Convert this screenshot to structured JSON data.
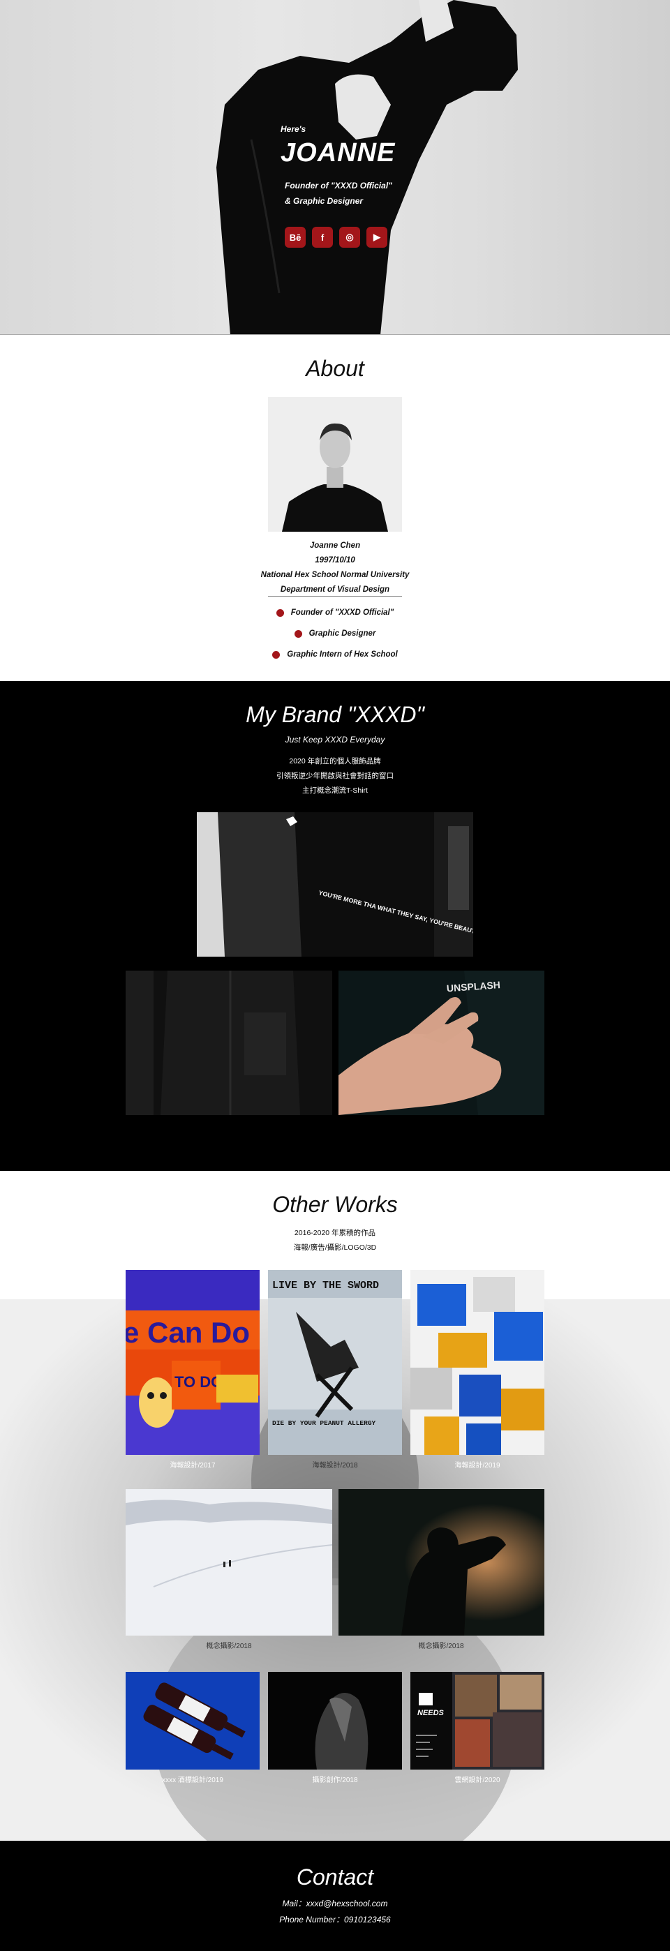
{
  "hero": {
    "greeting": "Here's",
    "name": "JOANNE",
    "role_line1": "Founder of \"XXXD Official\"",
    "role_line2": "& Graphic Designer",
    "socials": [
      {
        "name": "behance",
        "glyph": "Bē"
      },
      {
        "name": "facebook",
        "glyph": "f"
      },
      {
        "name": "instagram",
        "glyph": "◎"
      },
      {
        "name": "youtube",
        "glyph": "▶"
      }
    ],
    "accent": "#a3161a"
  },
  "about": {
    "title": "About",
    "name": "Joanne Chen",
    "birthday": "1997/10/10",
    "school": "National Hex School Normal University",
    "department": "Department of Visual Design",
    "roles": [
      "Founder of \"XXXD Official\"",
      "Graphic Designer",
      "Graphic Intern of Hex School"
    ]
  },
  "brand": {
    "title": "My Brand \"XXXD\"",
    "tagline": "Just Keep XXXD Everyday",
    "desc1": "2020 年創立的個人服飾品牌",
    "desc2": "引領叛逆少年開啟與社會對話的窗口",
    "desc3": "主打概念潮流T-Shirt",
    "shirt_text": "YOU'RE MORE THA WHAT THEY SAY, YOU'RE BEAUTIFUL & BRAVE",
    "unsplash_text": "UNSPLASH"
  },
  "works": {
    "title": "Other Works",
    "sub1": "2016-2020 年累積的作品",
    "sub2": "海報/廣告/攝影/LOGO/3D",
    "poster1_text": "e Can Do",
    "poster1_todo": "TO DO !!",
    "poster2_top": "LIVE BY THE SWORD",
    "poster2_bottom": "DIE BY YOUR PEANUT ALLERGY",
    "needs_label": "NEEDS",
    "captions": [
      "海報設計/2017",
      "海報設計/2018",
      "海報設計/2019",
      "概念攝影/2018",
      "概念攝影/2018",
      "xxxx 酒標設計/2019",
      "攝影創作/2018",
      "雲網設計/2020"
    ]
  },
  "contact": {
    "title": "Contact",
    "mail": "Mail：xxxd@hexschool.com",
    "phone": "Phone Number：0910123456"
  }
}
